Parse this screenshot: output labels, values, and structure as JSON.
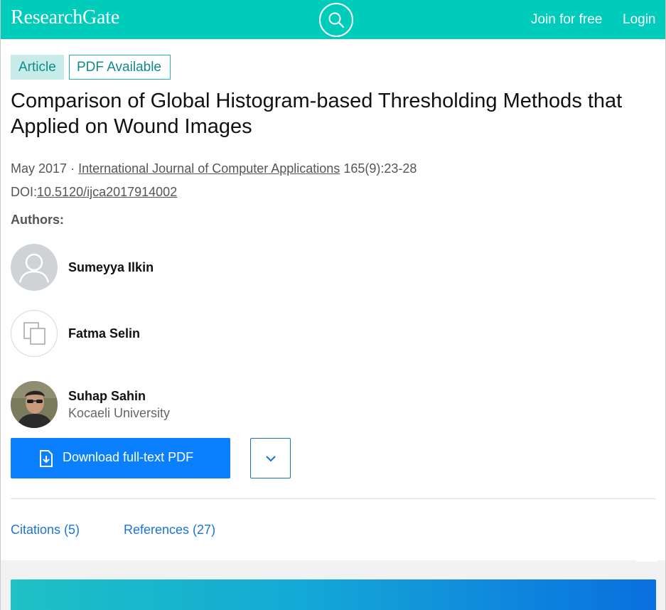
{
  "header": {
    "logo": "ResearchGate",
    "search_icon": "search-icon",
    "join_label": "Join for free",
    "login_label": "Login",
    "background_color": "#00ccbb"
  },
  "badges": {
    "article": "Article",
    "pdf_available": "PDF Available"
  },
  "article": {
    "title": "Comparison of Global Histogram-based Thresholding Methods that Applied on Wound Images",
    "date": "May 2017",
    "separator": "·",
    "journal": "International Journal of Computer Applications",
    "volume": "165(9):23-28",
    "doi_prefix": "DOI:",
    "doi": "10.5120/ijca2017914002"
  },
  "authors_heading": "Authors:",
  "authors": [
    {
      "name": "Sumeyya Ilkin",
      "affiliation": "",
      "avatar": "default-person-icon"
    },
    {
      "name": "Fatma Selin",
      "affiliation": "",
      "avatar": "institution-icon"
    },
    {
      "name": "Suhap Sahin",
      "affiliation": "Kocaeli University",
      "avatar": "profile-photo"
    }
  ],
  "actions": {
    "download_label": "Download full-text PDF",
    "download_icon": "pdf-download-icon",
    "more_icon": "chevron-down-icon",
    "accent_color": "#0a80ff"
  },
  "tabs": [
    {
      "label": "Citations (5)"
    },
    {
      "label": "References (27)"
    }
  ]
}
